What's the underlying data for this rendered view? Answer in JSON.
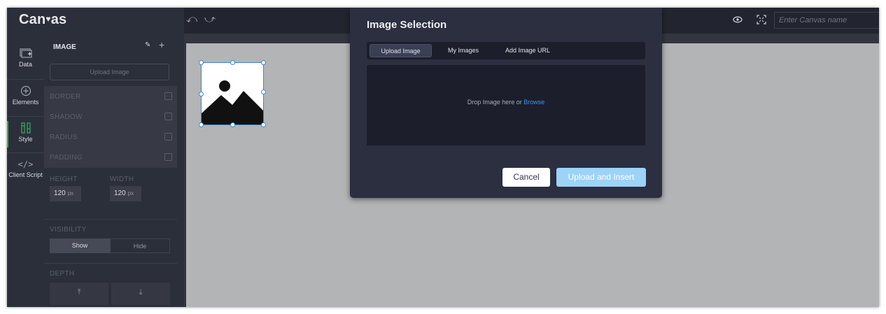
{
  "app": {
    "logo_text_a": "Can",
    "logo_text_b": "as",
    "canvas_name_placeholder": "Enter Canvas name"
  },
  "rail": {
    "items": [
      {
        "label": "Data",
        "icon": "data-icon"
      },
      {
        "label": "Elements",
        "icon": "elements-icon"
      },
      {
        "label": "Style",
        "icon": "style-icon"
      },
      {
        "label": "Client Script",
        "icon": "code-icon"
      }
    ]
  },
  "panel": {
    "title": "IMAGE",
    "upload_label": "Upload Image",
    "options": [
      "BORDER",
      "SHADOW",
      "RADIUS",
      "PADDING"
    ],
    "height_label": "HEIGHT",
    "width_label": "WIDTH",
    "height_value": "120",
    "width_value": "120",
    "unit": "px",
    "visibility_label": "VISIBILITY",
    "show_label": "Show",
    "hide_label": "Hide",
    "depth_label": "DEPTH",
    "depth_up": "⤒",
    "depth_down": "⤓"
  },
  "modal": {
    "title": "Image Selection",
    "tabs": [
      "Upload Image",
      "My Images",
      "Add Image URL"
    ],
    "drop_text": "Drop Image here or ",
    "browse_text": "Browse",
    "cancel_label": "Cancel",
    "insert_label": "Upload and Insert"
  },
  "colors": {
    "accent_blue": "#3e8ef5",
    "insert_button": "#9dd3f7",
    "selection": "#3a87cf",
    "style_marker": "#3fa35c"
  }
}
